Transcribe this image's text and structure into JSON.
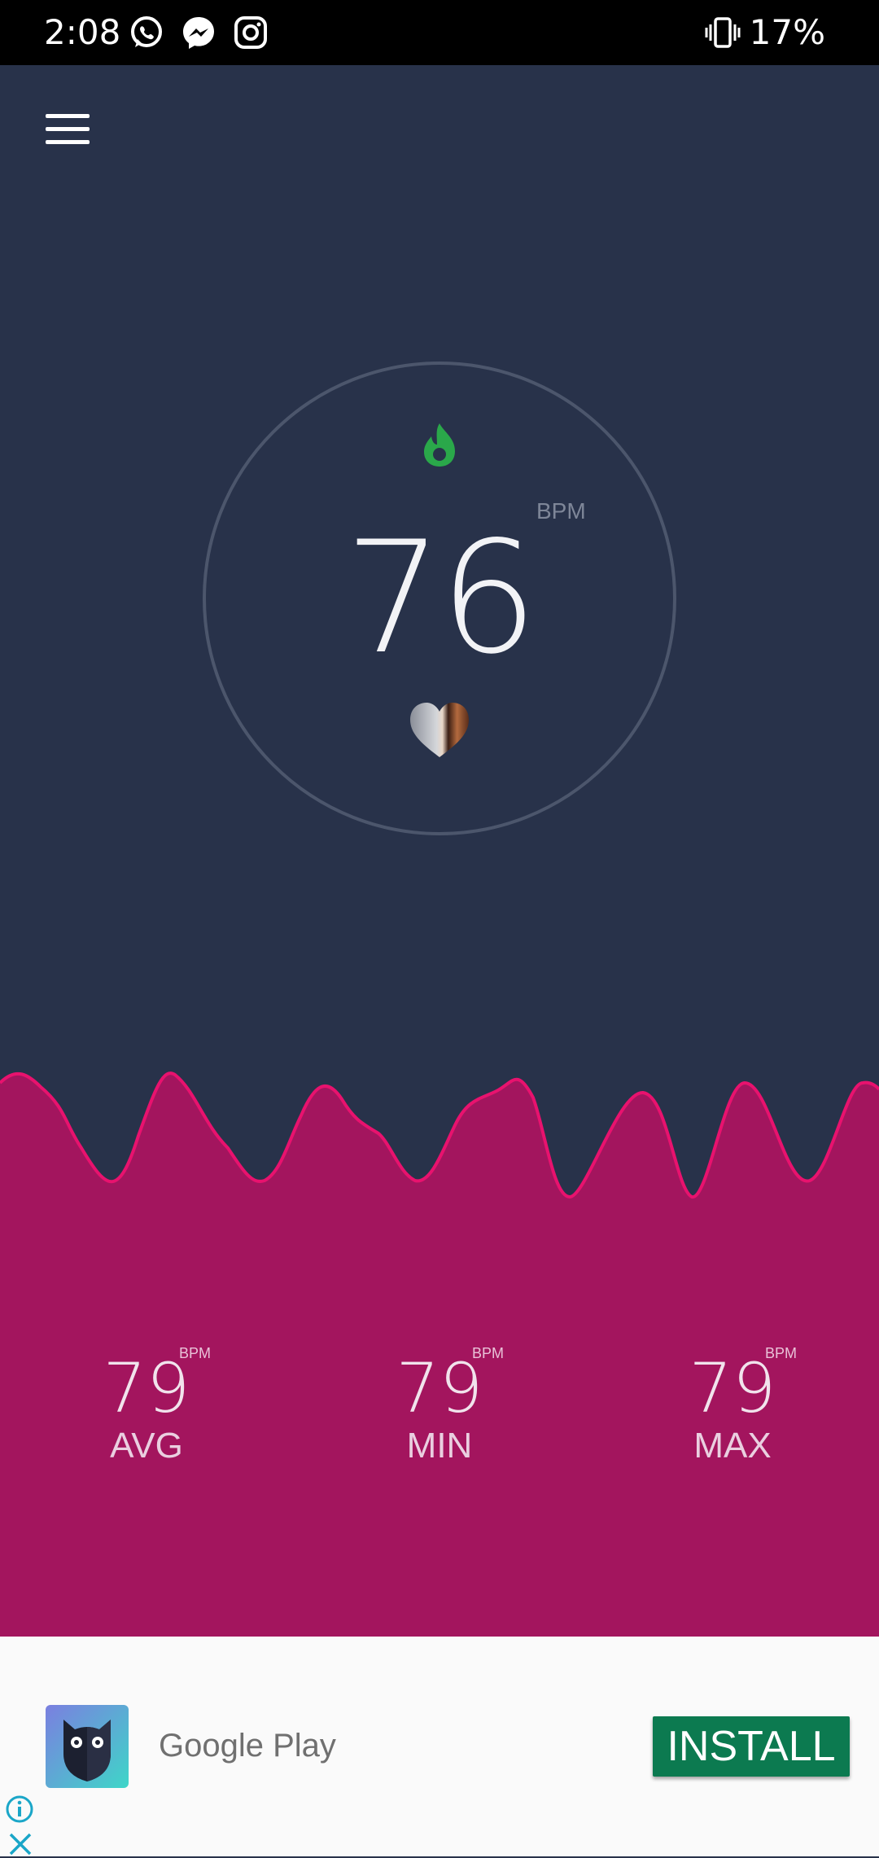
{
  "status_bar": {
    "time": "2:08",
    "battery": "17%",
    "icons": [
      "whatsapp-icon",
      "messenger-icon",
      "instagram-icon",
      "vibrate-icon"
    ]
  },
  "main": {
    "current_bpm": "76",
    "bpm_label": "BPM",
    "colors": {
      "background": "#28324a",
      "wave": "#a3155e",
      "wave_line": "#e8126e",
      "flame": "#2aa84a"
    }
  },
  "stats": [
    {
      "value": "79",
      "unit": "BPM",
      "label": "AVG"
    },
    {
      "value": "79",
      "unit": "BPM",
      "label": "MIN"
    },
    {
      "value": "79",
      "unit": "BPM",
      "label": "MAX"
    }
  ],
  "ad": {
    "store": "Google Play",
    "install_label": "INSTALL"
  }
}
